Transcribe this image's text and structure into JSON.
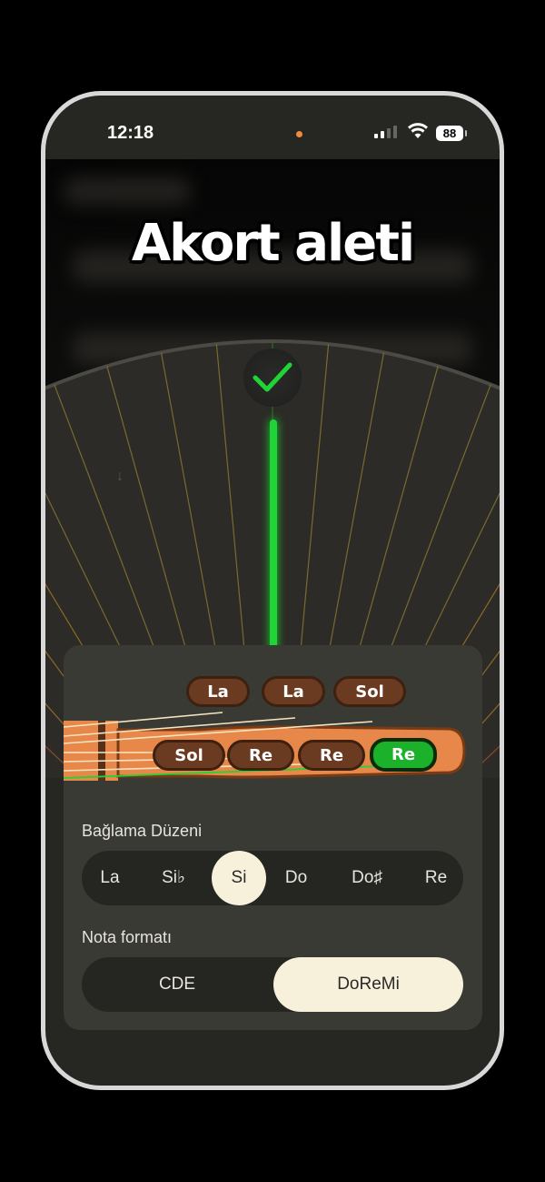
{
  "status_bar": {
    "time": "12:18",
    "battery": "88"
  },
  "title": "Akort aleti",
  "tuner": {
    "in_tune_icon": "checkmark-icon",
    "needle_color": "#1ed436"
  },
  "pegs": {
    "top": [
      "La",
      "La",
      "Sol"
    ],
    "bottom": [
      "Sol",
      "Re",
      "Re",
      "Re"
    ],
    "active_bottom_index": 3
  },
  "tuning": {
    "label": "Bağlama Düzeni",
    "options": [
      "La",
      "Si♭",
      "Si",
      "Do",
      "Do♯",
      "Re"
    ],
    "selected_index": 2
  },
  "note_format": {
    "label": "Nota formatı",
    "options": [
      "CDE",
      "DoReMi"
    ],
    "selected_index": 1
  },
  "colors": {
    "accent_green": "#1ed436",
    "neck_orange": "#e8874a",
    "peg_brown": "#6a3b21",
    "cream": "#f7f1dc"
  }
}
